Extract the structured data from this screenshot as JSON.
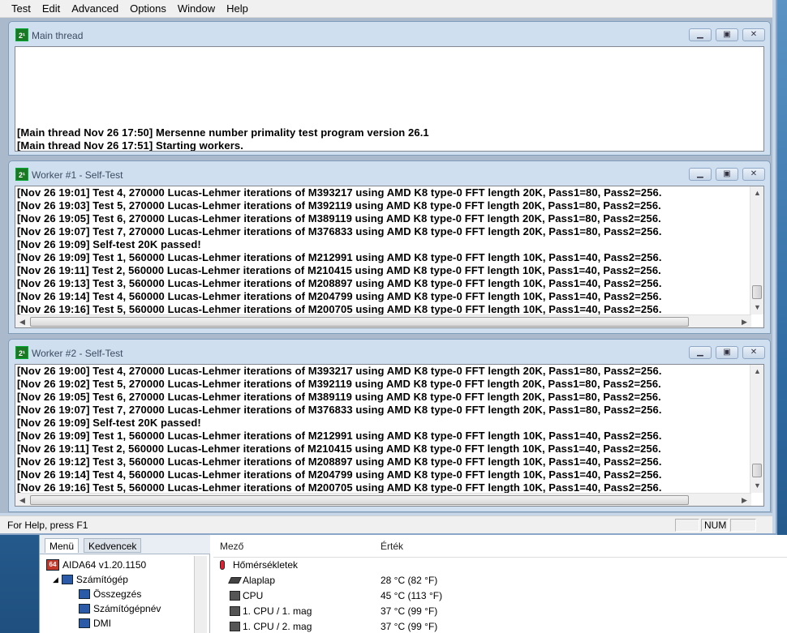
{
  "menu": [
    "Test",
    "Edit",
    "Advanced",
    "Options",
    "Window",
    "Help"
  ],
  "main_thread": {
    "title": "Main thread",
    "lines": [
      "[Main thread Nov 26 17:50] Mersenne number primality test program version 26.1",
      "[Main thread Nov 26 17:51] Starting workers."
    ]
  },
  "worker1": {
    "title": "Worker #1 - Self-Test",
    "lines": [
      "[Nov 26 19:01] Test 4, 270000 Lucas-Lehmer iterations of M393217 using AMD K8 type-0 FFT length 20K, Pass1=80, Pass2=256.",
      "[Nov 26 19:03] Test 5, 270000 Lucas-Lehmer iterations of M392119 using AMD K8 type-0 FFT length 20K, Pass1=80, Pass2=256.",
      "[Nov 26 19:05] Test 6, 270000 Lucas-Lehmer iterations of M389119 using AMD K8 type-0 FFT length 20K, Pass1=80, Pass2=256.",
      "[Nov 26 19:07] Test 7, 270000 Lucas-Lehmer iterations of M376833 using AMD K8 type-0 FFT length 20K, Pass1=80, Pass2=256.",
      "[Nov 26 19:09] Self-test 20K passed!",
      "[Nov 26 19:09] Test 1, 560000 Lucas-Lehmer iterations of M212991 using AMD K8 type-0 FFT length 10K, Pass1=40, Pass2=256.",
      "[Nov 26 19:11] Test 2, 560000 Lucas-Lehmer iterations of M210415 using AMD K8 type-0 FFT length 10K, Pass1=40, Pass2=256.",
      "[Nov 26 19:13] Test 3, 560000 Lucas-Lehmer iterations of M208897 using AMD K8 type-0 FFT length 10K, Pass1=40, Pass2=256.",
      "[Nov 26 19:14] Test 4, 560000 Lucas-Lehmer iterations of M204799 using AMD K8 type-0 FFT length 10K, Pass1=40, Pass2=256.",
      "[Nov 26 19:16] Test 5, 560000 Lucas-Lehmer iterations of M200705 using AMD K8 type-0 FFT length 10K, Pass1=40, Pass2=256."
    ]
  },
  "worker2": {
    "title": "Worker #2 - Self-Test",
    "lines": [
      "[Nov 26 19:00] Test 4, 270000 Lucas-Lehmer iterations of M393217 using AMD K8 type-0 FFT length 20K, Pass1=80, Pass2=256.",
      "[Nov 26 19:02] Test 5, 270000 Lucas-Lehmer iterations of M392119 using AMD K8 type-0 FFT length 20K, Pass1=80, Pass2=256.",
      "[Nov 26 19:05] Test 6, 270000 Lucas-Lehmer iterations of M389119 using AMD K8 type-0 FFT length 20K, Pass1=80, Pass2=256.",
      "[Nov 26 19:07] Test 7, 270000 Lucas-Lehmer iterations of M376833 using AMD K8 type-0 FFT length 20K, Pass1=80, Pass2=256.",
      "[Nov 26 19:09] Self-test 20K passed!",
      "[Nov 26 19:09] Test 1, 560000 Lucas-Lehmer iterations of M212991 using AMD K8 type-0 FFT length 10K, Pass1=40, Pass2=256.",
      "[Nov 26 19:11] Test 2, 560000 Lucas-Lehmer iterations of M210415 using AMD K8 type-0 FFT length 10K, Pass1=40, Pass2=256.",
      "[Nov 26 19:12] Test 3, 560000 Lucas-Lehmer iterations of M208897 using AMD K8 type-0 FFT length 10K, Pass1=40, Pass2=256.",
      "[Nov 26 19:14] Test 4, 560000 Lucas-Lehmer iterations of M204799 using AMD K8 type-0 FFT length 10K, Pass1=40, Pass2=256.",
      "[Nov 26 19:16] Test 5, 560000 Lucas-Lehmer iterations of M200705 using AMD K8 type-0 FFT length 10K, Pass1=40, Pass2=256."
    ]
  },
  "status": {
    "help_text": "For Help, press F1",
    "num": "NUM"
  },
  "aida": {
    "tabs": [
      "Menü",
      "Kedvencek"
    ],
    "app_version": "AIDA64 v1.20.1150",
    "tree": [
      "Számítógép",
      "Összegzés",
      "Számítógépnév",
      "DMI"
    ],
    "columns": [
      "Mező",
      "Érték"
    ],
    "rows": [
      {
        "field": "Hőmérsékletek",
        "value": ""
      },
      {
        "field": "Alaplap",
        "value": "28 °C  (82 °F)"
      },
      {
        "field": "CPU",
        "value": "45 °C  (113 °F)"
      },
      {
        "field": "1. CPU / 1. mag",
        "value": "37 °C  (99 °F)"
      },
      {
        "field": "1. CPU / 2. mag",
        "value": "37 °C  (99 °F)"
      }
    ]
  },
  "icons": {
    "child_window": "prime95-icon",
    "minimize": "minimize-icon",
    "restore": "restore-icon",
    "close": "close-icon"
  }
}
